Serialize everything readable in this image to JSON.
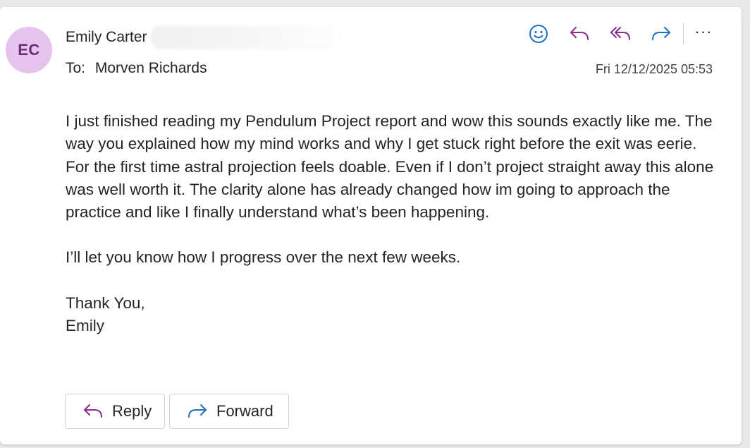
{
  "sender": {
    "initials": "EC",
    "name": "Emily Carter"
  },
  "recipient": {
    "label": "To:",
    "name": "Morven Richards"
  },
  "date": "Fri 12/12/2025 05:53",
  "toolbar": {
    "emoji_icon": "emoji-icon",
    "reply_icon": "reply-icon",
    "reply_all_icon": "reply-all-icon",
    "forward_icon": "forward-icon",
    "more_label": "···"
  },
  "message": {
    "paragraph1": "I just finished reading my Pendulum Project report and wow this sounds exactly like me. The way you explained how my mind works and why I get stuck right before the exit was eerie. For the first time astral projection feels doable. Even if I don’t project straight away this alone was well worth it. The clarity alone has already changed how im going to approach the practice and like I finally understand what’s been happening.",
    "paragraph2": "I’ll let you know how I progress over the next few weeks.",
    "signoff": "Thank You,",
    "signature": "Emily"
  },
  "buttons": {
    "reply_label": "Reply",
    "forward_label": "Forward"
  },
  "colors": {
    "accent_reply": "#8a2d8e",
    "accent_forward": "#1f6fc4",
    "avatar_bg": "#e6c3ec",
    "avatar_text": "#6a2c78"
  }
}
